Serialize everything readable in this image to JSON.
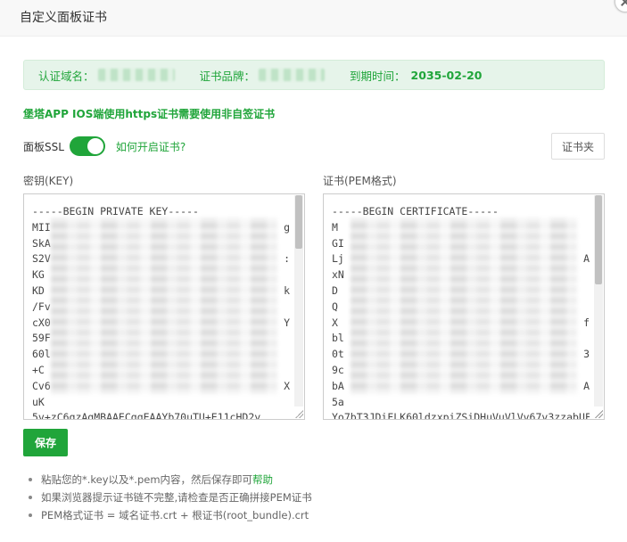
{
  "window": {
    "title": "自定义面板证书"
  },
  "info": {
    "domain_label": "认证域名：",
    "brand_label": "证书品牌：",
    "expiry_label": "到期时间：",
    "expiry_value": "2035-02-20"
  },
  "notice_link": "堡塔APP IOS端使用https证书需要使用非自签证书",
  "ssl": {
    "label": "面板SSL",
    "enabled": true,
    "help_link": "如何开启证书?"
  },
  "cert_folder_button": "证书夹",
  "key": {
    "label": "密钥(KEY)",
    "lines": [
      "-----BEGIN PRIVATE KEY-----",
      "MII",
      "SkA",
      "S2V",
      "KG",
      "KD",
      "/Fv",
      "cX0",
      "59F",
      "60l",
      "+C",
      "Cv6",
      "uK",
      "5v+zC6qzAgMBAAECggEAAYb70uTU+E11cHD2y"
    ],
    "right_fragments": [
      "",
      "g",
      "",
      ":",
      "",
      "k",
      "",
      "Y",
      "",
      "",
      "",
      "X",
      "",
      ""
    ]
  },
  "cert": {
    "label": "证书(PEM格式)",
    "lines": [
      "-----BEGIN CERTIFICATE-----",
      "M",
      "GI",
      "Lj",
      "xN",
      "D",
      "Q",
      "X",
      "bl",
      "0t",
      "9c",
      "bA",
      "5a",
      "Yo7bT3JDiFLK60ldzxpiZSiDHuVuVlVv67v3zzabUF"
    ],
    "right_fragments": [
      "",
      "",
      "",
      "A",
      "",
      "",
      "",
      "f",
      "",
      "3",
      "",
      "A",
      "",
      ""
    ]
  },
  "save_button": "保存",
  "notes": [
    {
      "text": "粘贴您的*.key以及*.pem内容，然后保存即可",
      "link": "帮助"
    },
    {
      "text": "如果浏览器提示证书链不完整,请检查是否正确拼接PEM证书",
      "link": ""
    },
    {
      "text": "PEM格式证书 = 域名证书.crt + 根证书(root_bundle).crt",
      "link": ""
    }
  ],
  "colors": {
    "accent": "#20a53a",
    "info_bg": "#e6f4ea"
  }
}
